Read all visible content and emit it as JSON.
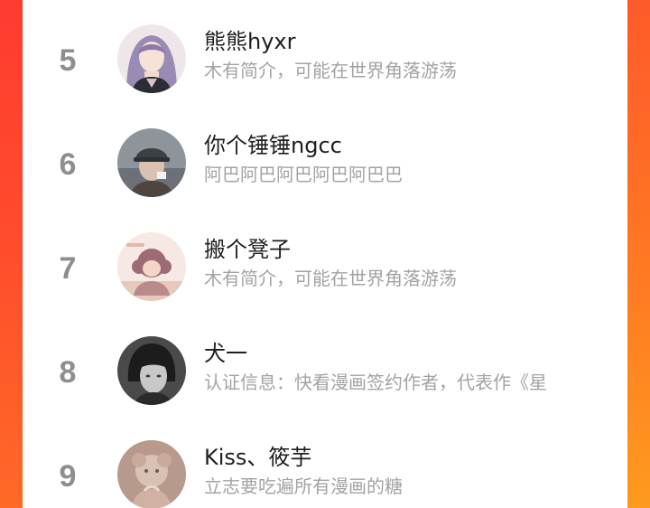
{
  "ranking": {
    "items": [
      {
        "rank": "5",
        "name": "熊熊hyxr",
        "bio": "木有简介，可能在世界角落游荡",
        "avatar": "anime-girl-avatar"
      },
      {
        "rank": "6",
        "name": "你个锤锤ngcc",
        "bio": "阿巴阿巴阿巴阿巴阿巴巴",
        "avatar": "man-with-cap-avatar"
      },
      {
        "rank": "7",
        "name": "搬个凳子",
        "bio": "木有简介，可能在世界角落游荡",
        "avatar": "cartoon-girl-avatar"
      },
      {
        "rank": "8",
        "name": "犬一",
        "bio": "认证信息：快看漫画签约作者，代表作《星",
        "avatar": "monochrome-portrait-avatar"
      },
      {
        "rank": "9",
        "name": "Kiss、筱芋",
        "bio": "立志要吃遍所有漫画的糖",
        "avatar": "doll-avatar"
      }
    ]
  },
  "colors": {
    "background_edge": "#ff4a2c",
    "card": "#ffffff",
    "rank_text": "#8e8e8e",
    "name_text": "#1f1f1f",
    "bio_text": "#a3a3a3"
  }
}
